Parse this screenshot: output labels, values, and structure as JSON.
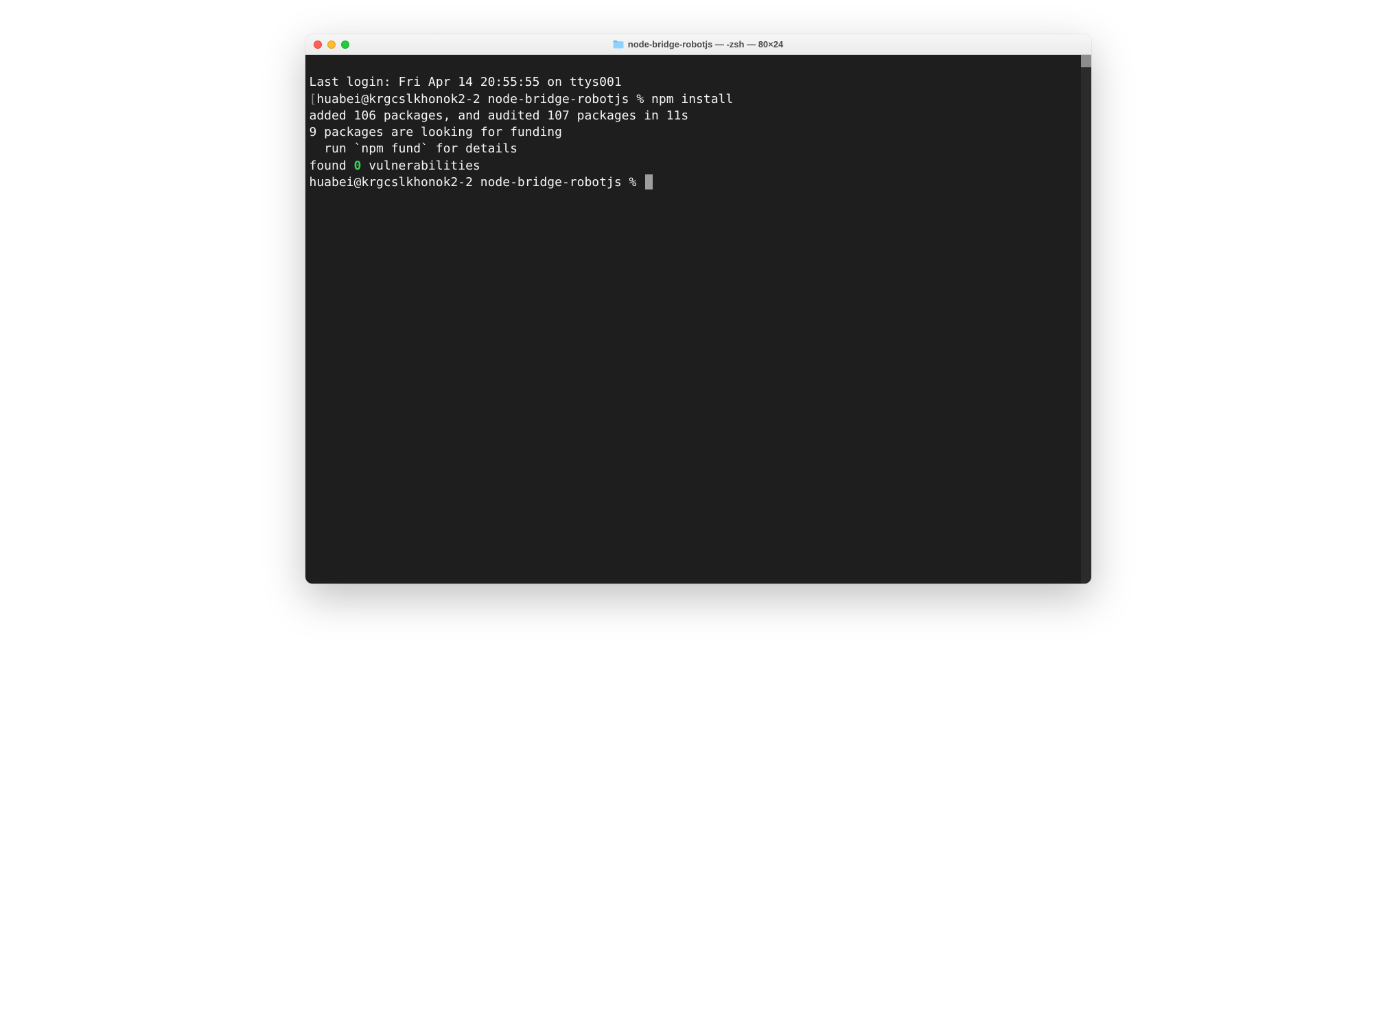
{
  "window": {
    "title": "node-bridge-robotjs — -zsh — 80×24"
  },
  "terminal": {
    "lastLogin": "Last login: Fri Apr 14 20:55:55 on ttys001",
    "prompt1_prefix": "[",
    "prompt1_text": "huabei@krgcslkhonok2-2 node-bridge-robotjs % ",
    "prompt1_cmd": "npm install",
    "prompt1_suffix": "]",
    "blank1": "",
    "added": "added 106 packages, and audited 107 packages in 11s",
    "blank2": "",
    "funding1": "9 packages are looking for funding",
    "funding2": "  run `npm fund` for details",
    "blank3": "",
    "vuln_prefix": "found ",
    "vuln_count": "0",
    "vuln_suffix": " vulnerabilities",
    "prompt2": "huabei@krgcslkhonok2-2 node-bridge-robotjs % "
  }
}
